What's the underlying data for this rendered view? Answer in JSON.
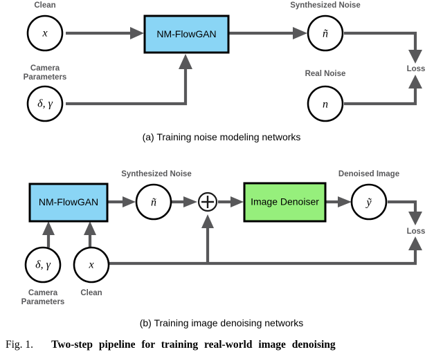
{
  "figure": {
    "caption_number": "Fig. 1.",
    "caption_text": "Two-step pipeline for training real-world image denoising",
    "subcaption_a": "(a) Training noise modeling networks",
    "subcaption_b": "(b) Training image denoising networks"
  },
  "colors": {
    "flowgan_box": "#8ad5f5",
    "denoiser_box": "#96ef7c",
    "arrow": "#58585a",
    "label_text": "#58585a",
    "outline": "#000000"
  },
  "panel_a": {
    "nodes": {
      "clean": {
        "label": "Clean",
        "symbol": "x"
      },
      "camera_parameters": {
        "label_line1": "Camera",
        "label_line2": "Parameters",
        "symbol": "δ, γ"
      },
      "synthesized_noise": {
        "label": "Synthesized Noise",
        "symbol": "ñ"
      },
      "real_noise": {
        "label": "Real Noise",
        "symbol": "n"
      }
    },
    "blocks": {
      "flowgan": {
        "label": "NM-FlowGAN"
      }
    },
    "loss": {
      "label": "Loss"
    }
  },
  "panel_b": {
    "nodes": {
      "camera_parameters": {
        "label_line1": "Camera",
        "label_line2": "Parameters",
        "symbol": "δ, γ"
      },
      "clean": {
        "label": "Clean",
        "symbol": "x"
      },
      "synthesized_noise": {
        "label": "Synthesized Noise",
        "symbol": "ñ"
      },
      "denoised_image": {
        "label": "Denoised Image",
        "symbol": "ỹ"
      }
    },
    "blocks": {
      "flowgan": {
        "label": "NM-FlowGAN"
      },
      "denoiser": {
        "label": "Image Denoiser"
      }
    },
    "operator": {
      "name": "addition",
      "symbol": "⊕"
    },
    "loss": {
      "label": "Loss"
    }
  }
}
